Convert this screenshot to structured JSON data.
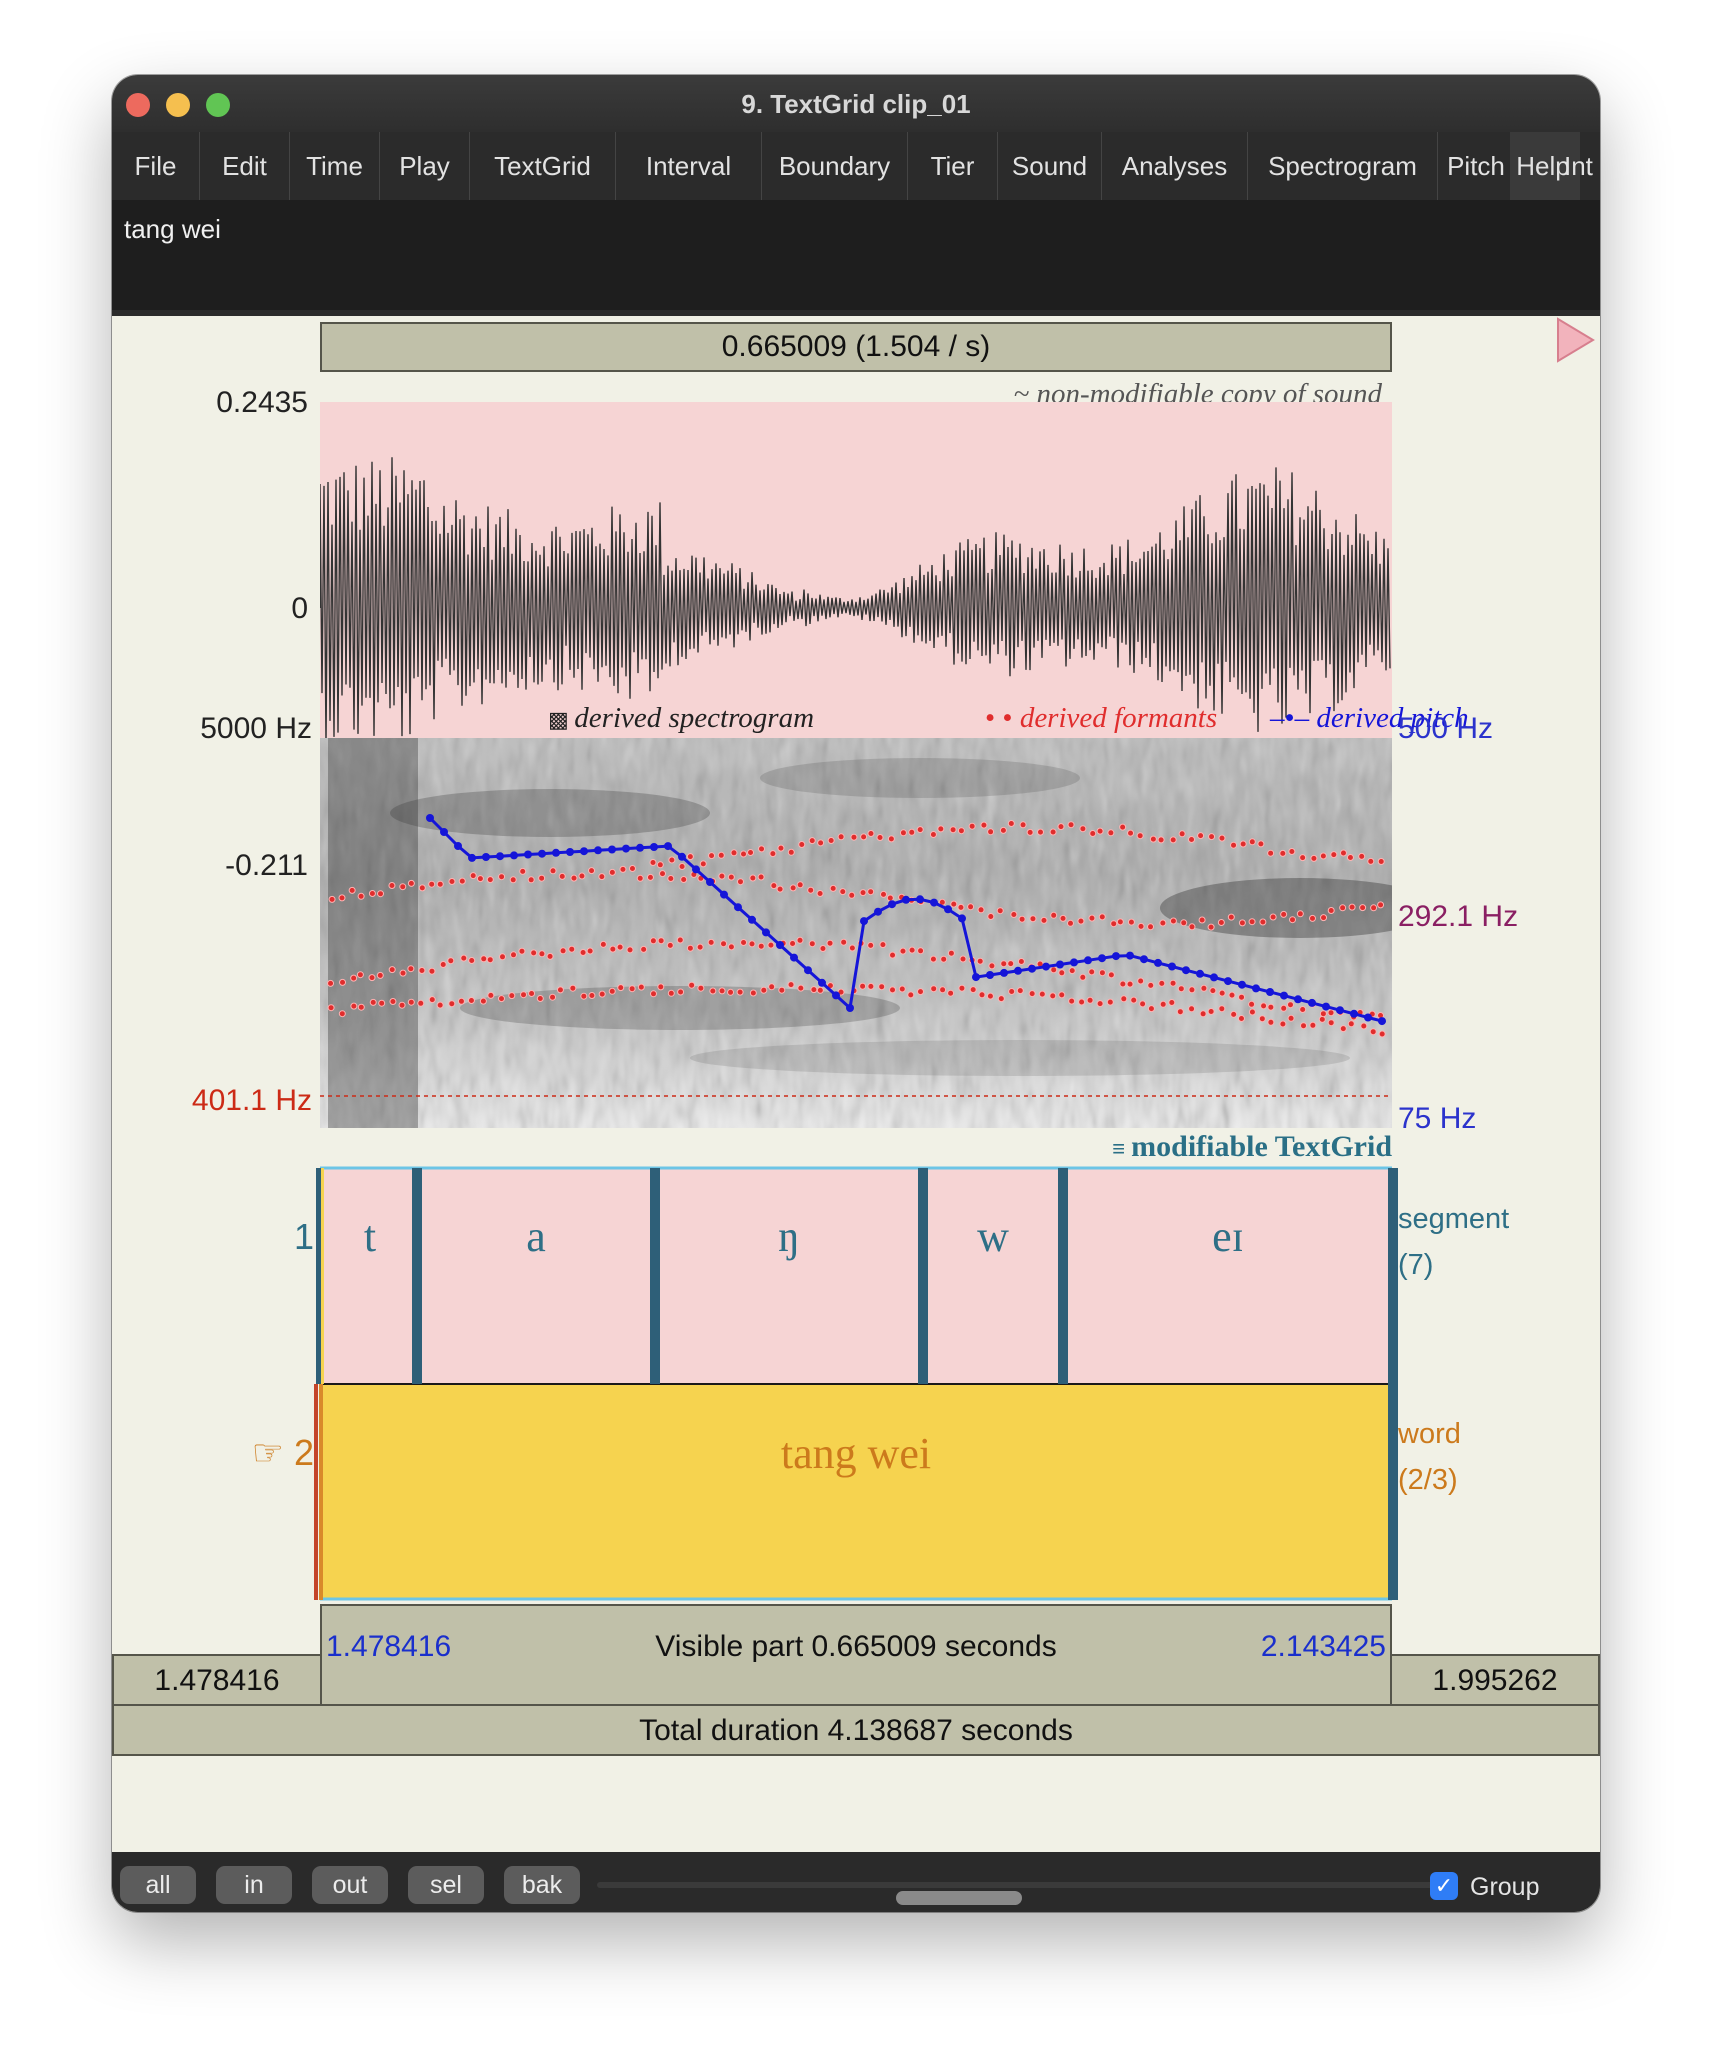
{
  "window": {
    "title": "9. TextGrid clip_01"
  },
  "menu": [
    "File",
    "Edit",
    "Time",
    "Play",
    "TextGrid",
    "Interval",
    "Boundary",
    "Tier",
    "Sound",
    "Analyses",
    "Spectrogram",
    "Pitch",
    "Help",
    "Int"
  ],
  "info_text": "tang wei",
  "selection_top": "0.665009 (1.504 / s)",
  "sound": {
    "caption": "~ non-modifiable copy of sound",
    "max_label": "0.2435",
    "zero_label": "0",
    "min_label": "-0.211"
  },
  "analysis": {
    "spectrogram_label": "derived spectrogram",
    "formants_label": "derived formants",
    "pitch_label": "derived pitch",
    "freq_top": "5000 Hz",
    "freq_cursor": "401.1 Hz",
    "pitch_top": "500 Hz",
    "pitch_cursor": "292.1 Hz",
    "pitch_bottom": "75 Hz"
  },
  "textgrid": {
    "caption": "modifiable TextGrid",
    "tier1": {
      "number": "1",
      "name": "segment",
      "count": "(7)",
      "intervals": [
        "t",
        "a",
        "ŋ",
        "w",
        "eɪ"
      ]
    },
    "tier2": {
      "number": "2",
      "pointer": "☞",
      "name": "word",
      "count": "(2/3)",
      "intervals": [
        "tang wei"
      ]
    }
  },
  "time": {
    "left_window": "1.478416",
    "visible_start": "1.478416",
    "visible_label": "Visible part 0.665009 seconds",
    "visible_end": "2.143425",
    "right_window": "1.995262",
    "total": "Total duration 4.138687 seconds"
  },
  "buttons": {
    "all": "all",
    "in": "in",
    "out": "out",
    "sel": "sel",
    "bak": "bak"
  },
  "group": {
    "label": "Group",
    "checked": true
  },
  "colors": {
    "waveform_bg": "#f6d4d4",
    "segment_bg": "#f6d4d4",
    "word_bg": "#f6d34f",
    "boundary": "#2e5f78",
    "pitch": "#1515d8",
    "formant": "#e02d2d",
    "cursor_freq": "#cc2a16"
  }
}
